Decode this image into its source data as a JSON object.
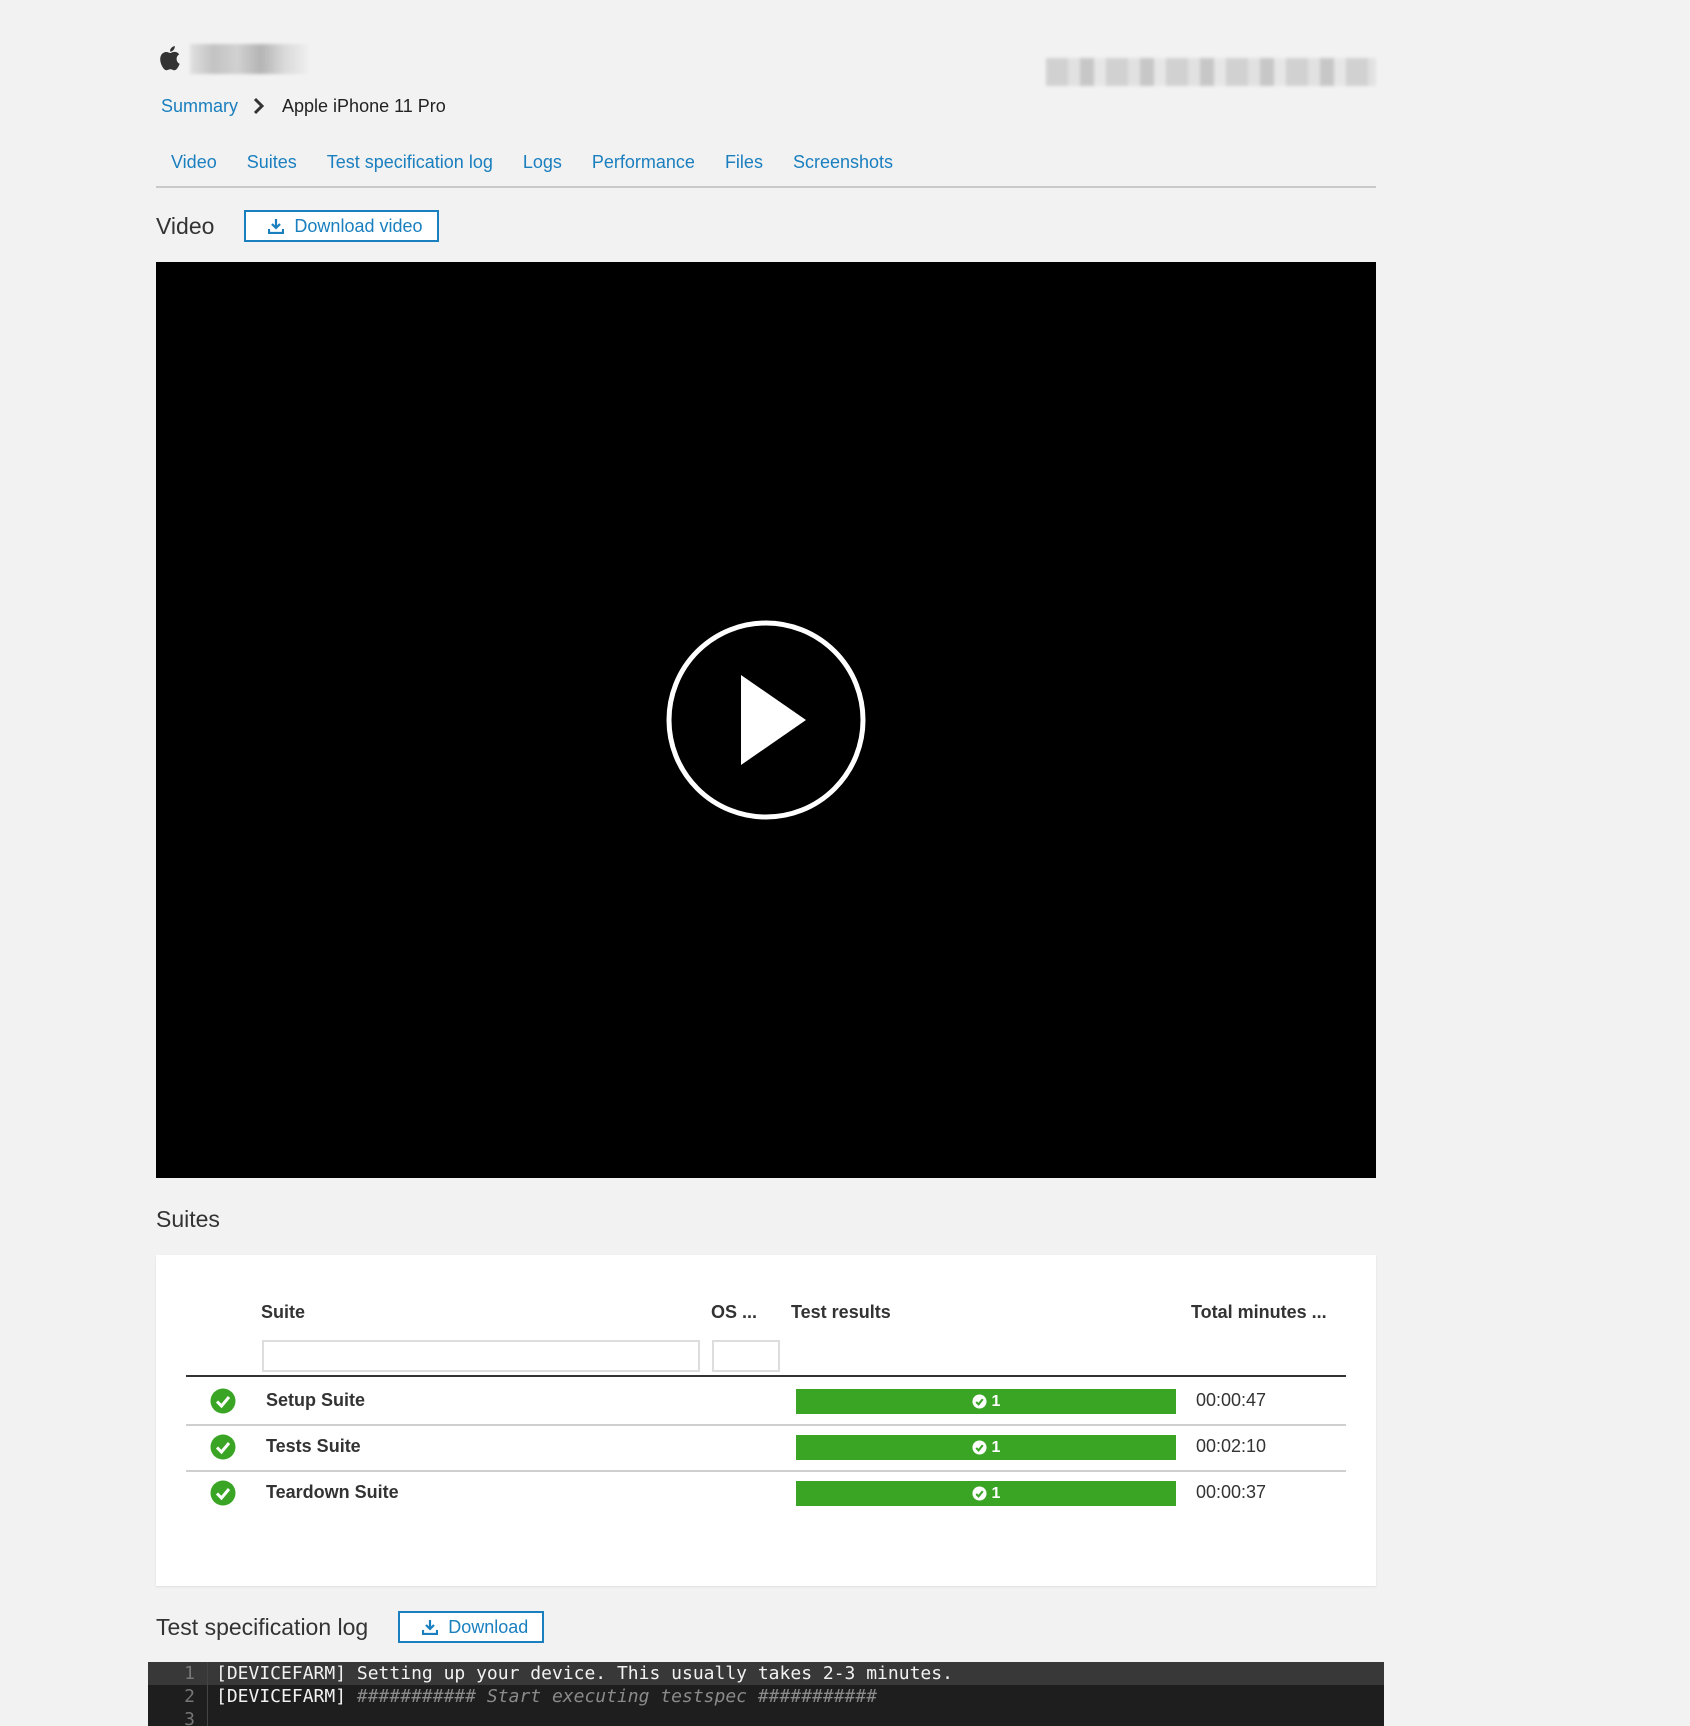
{
  "header": {
    "breadcrumb": {
      "summary": "Summary",
      "current": "Apple iPhone 11 Pro"
    }
  },
  "tabs": [
    "Video",
    "Suites",
    "Test specification log",
    "Logs",
    "Performance",
    "Files",
    "Screenshots"
  ],
  "video_section": {
    "title": "Video",
    "download_label": "Download video"
  },
  "suites_section": {
    "title": "Suites",
    "columns": {
      "suite": "Suite",
      "os": "OS ...",
      "results": "Test results",
      "minutes": "Total minutes ..."
    },
    "rows": [
      {
        "name": "Setup Suite",
        "passed": "1",
        "minutes": "00:00:47"
      },
      {
        "name": "Tests Suite",
        "passed": "1",
        "minutes": "00:02:10"
      },
      {
        "name": "Teardown Suite",
        "passed": "1",
        "minutes": "00:00:37"
      }
    ]
  },
  "spec_log_section": {
    "title": "Test specification log",
    "download_label": "Download",
    "lines": [
      {
        "num": "1",
        "prefix": "[DEVICEFARM]",
        "text": " Setting up your device. This usually takes 2-3 minutes."
      },
      {
        "num": "2",
        "prefix": "[DEVICEFARM]",
        "text": " ########### Start executing testspec ###########"
      },
      {
        "num": "3",
        "prefix": "",
        "text": ""
      }
    ]
  },
  "colors": {
    "accent": "#1a7fbf",
    "success": "#3aa524",
    "background": "#f2f2f2"
  }
}
